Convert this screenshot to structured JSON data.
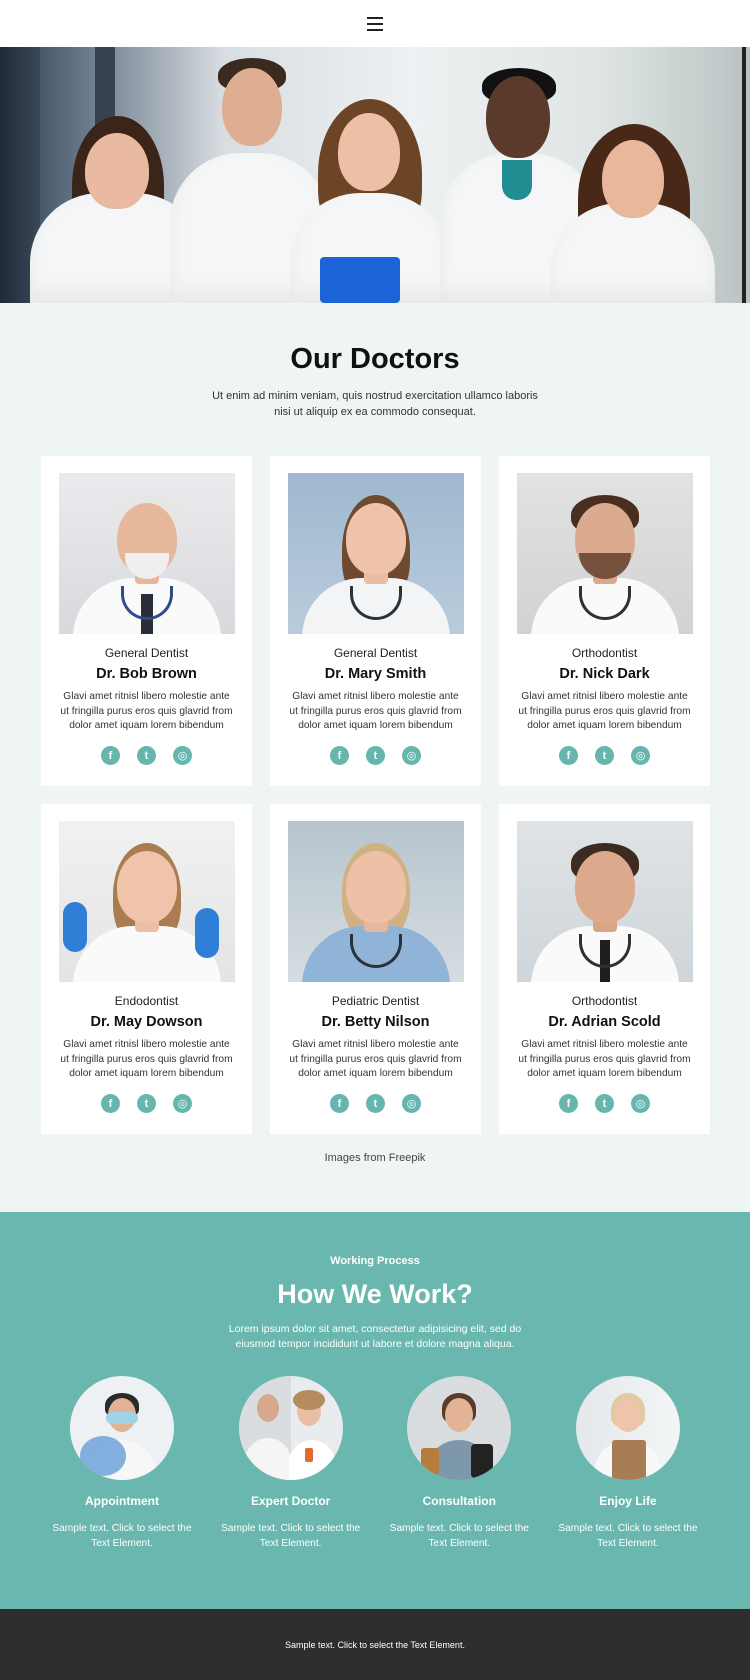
{
  "header": {
    "menu_icon": "hamburger-icon"
  },
  "doctors_section": {
    "title": "Our Doctors",
    "subtitle": "Ut enim ad minim veniam, quis nostrud exercitation ullamco laboris nisi ut aliquip ex ea commodo consequat.",
    "cards": [
      {
        "specialty": "General Dentist",
        "name": "Dr. Bob Brown",
        "description": "Glavi amet ritnisl libero molestie ante ut fringilla purus eros quis glavrid from dolor amet iquam lorem bibendum"
      },
      {
        "specialty": "General Dentist",
        "name": "Dr. Mary Smith",
        "description": "Glavi amet ritnisl libero molestie ante ut fringilla purus eros quis glavrid from dolor amet iquam lorem bibendum"
      },
      {
        "specialty": "Orthodontist",
        "name": "Dr. Nick Dark",
        "description": "Glavi amet ritnisl libero molestie ante ut fringilla purus eros quis glavrid from dolor amet iquam lorem bibendum"
      },
      {
        "specialty": "Endodontist",
        "name": "Dr. May Dowson",
        "description": "Glavi amet ritnisl libero molestie ante ut fringilla purus eros quis glavrid from dolor amet iquam lorem bibendum"
      },
      {
        "specialty": "Pediatric Dentist",
        "name": "Dr. Betty Nilson",
        "description": "Glavi amet ritnisl libero molestie ante ut fringilla purus eros quis glavrid from dolor amet iquam lorem bibendum"
      },
      {
        "specialty": "Orthodontist",
        "name": "Dr. Adrian Scold",
        "description": "Glavi amet ritnisl libero molestie ante ut fringilla purus eros quis glavrid from dolor amet iquam lorem bibendum"
      }
    ],
    "social_icons": [
      "facebook-icon",
      "twitter-icon",
      "instagram-icon"
    ],
    "credit": "Images from Freepik"
  },
  "process_section": {
    "eyebrow": "Working Process",
    "title": "How We Work?",
    "subtitle": "Lorem ipsum dolor sit amet, consectetur adipisicing elit, sed do eiusmod tempor incididunt ut labore et dolore magna aliqua.",
    "steps": [
      {
        "title": "Appointment",
        "text": "Sample text. Click to select the Text Element."
      },
      {
        "title": "Expert Doctor",
        "text": "Sample text. Click to select the Text Element."
      },
      {
        "title": "Consultation",
        "text": "Sample text. Click to select the Text Element."
      },
      {
        "title": "Enjoy Life",
        "text": "Sample text. Click to select the Text Element."
      }
    ]
  },
  "footer": {
    "text": "Sample text. Click to select the Text Element."
  },
  "colors": {
    "accent": "#69b7ae",
    "section_bg": "#eef5f4",
    "footer_bg": "#2e2e2e"
  }
}
